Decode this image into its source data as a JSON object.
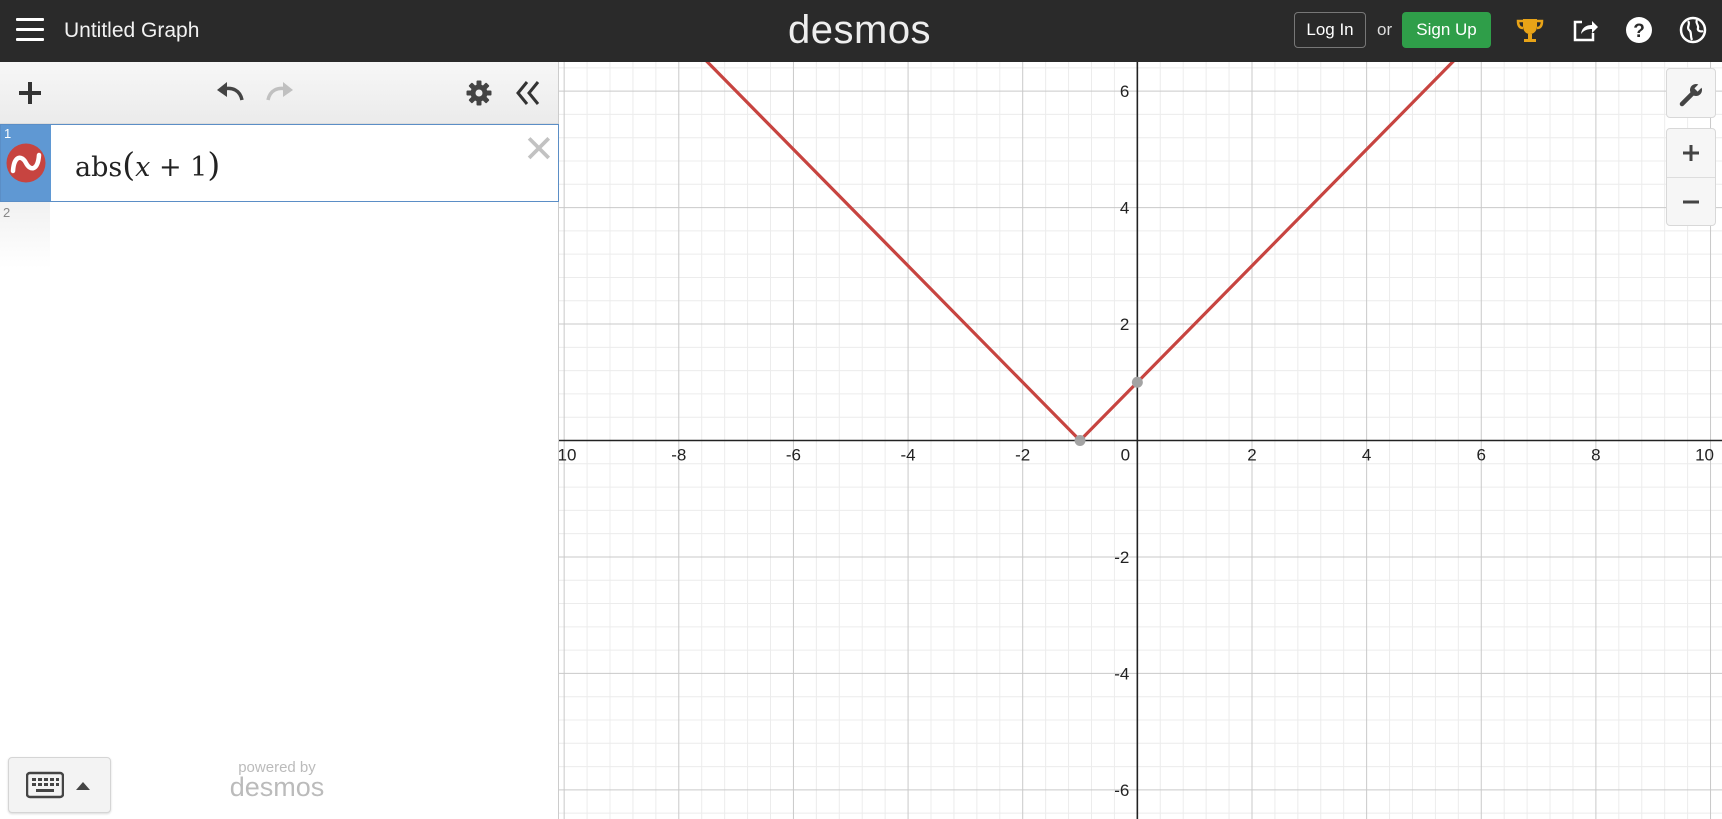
{
  "header": {
    "graph_title": "Untitled Graph",
    "brand": "desmos",
    "login_label": "Log In",
    "or_label": "or",
    "signup_label": "Sign Up"
  },
  "expressions": [
    {
      "index": "1",
      "latex": {
        "fn": "abs",
        "var": "x",
        "op": "+",
        "const": "1"
      },
      "color": "#c74440"
    },
    {
      "index": "2"
    }
  ],
  "footer": {
    "powered_by": "powered by",
    "brand": "desmos"
  },
  "chart_data": {
    "type": "line",
    "title": "",
    "xlabel": "",
    "ylabel": "",
    "xlim": [
      -10.09,
      10.2
    ],
    "ylim": [
      -6.5,
      6.5
    ],
    "x_ticks": [
      -10,
      -8,
      -6,
      -4,
      -2,
      0,
      2,
      4,
      6,
      8,
      10
    ],
    "y_ticks": [
      -6,
      -4,
      -2,
      2,
      4,
      6
    ],
    "grid": true,
    "series": [
      {
        "name": "",
        "color": "#c74440",
        "x": [
          -7.6,
          -1,
          5.6
        ],
        "y": [
          6.6,
          0,
          6.6
        ]
      }
    ],
    "points": [
      {
        "x": -1,
        "y": 0
      },
      {
        "x": 0,
        "y": 1
      }
    ]
  }
}
